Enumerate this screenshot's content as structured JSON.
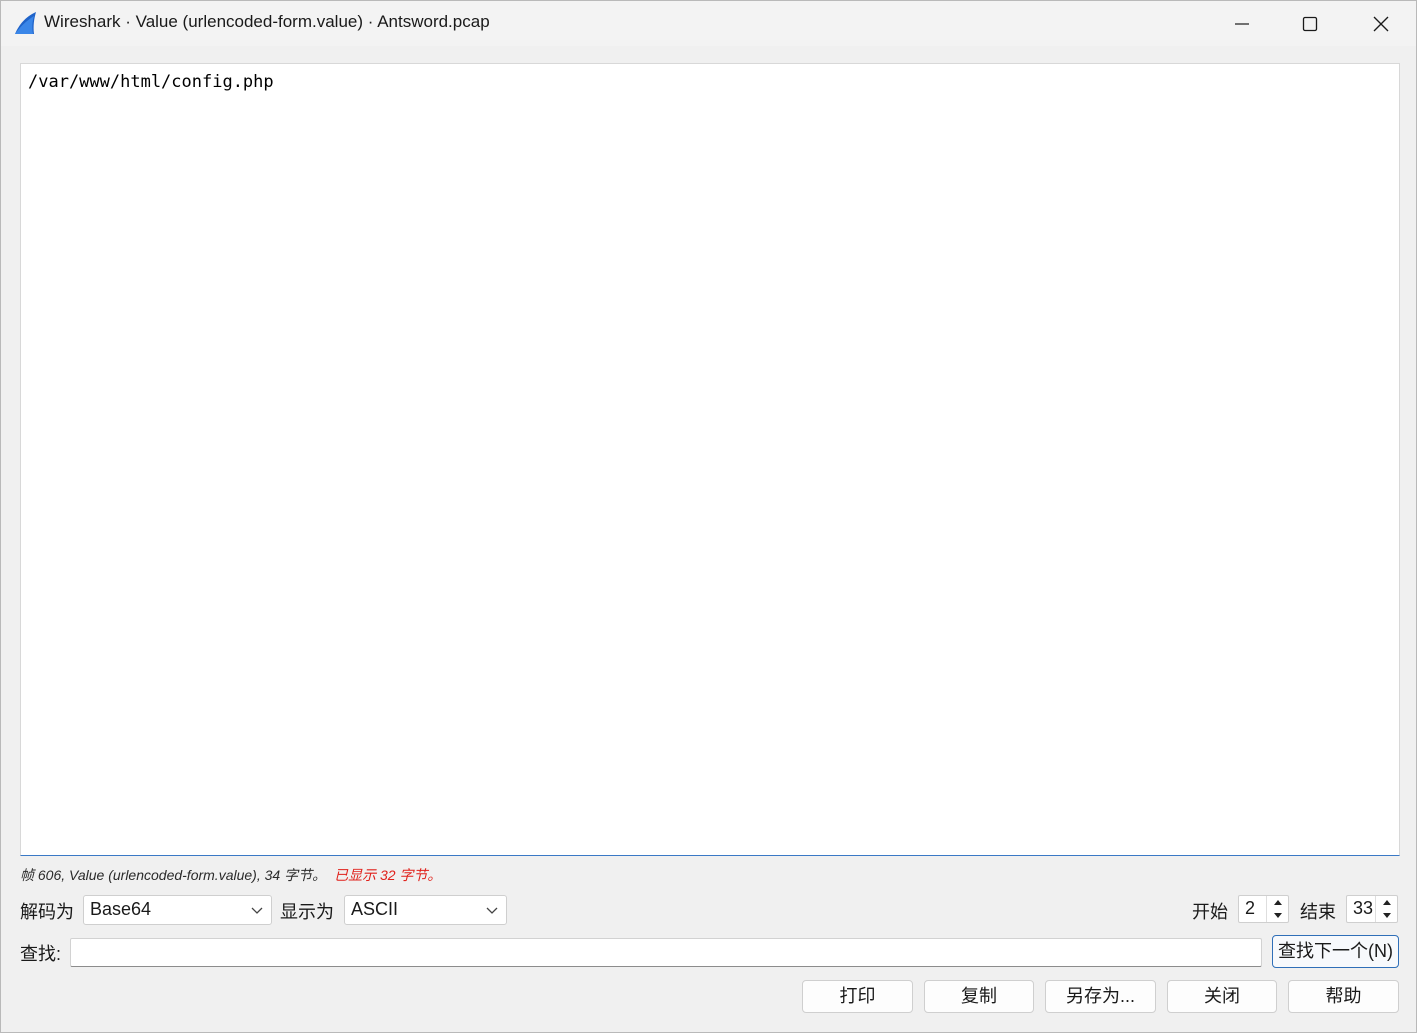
{
  "window": {
    "title": "Wireshark · Value (urlencoded-form.value) · Antsword.pcap"
  },
  "content": {
    "text": "/var/www/html/config.php"
  },
  "info": {
    "summary": "帧 606, Value (urlencoded-form.value), 34 字节。",
    "shown": "已显示 32 字节。"
  },
  "controls": {
    "decode_label": "解码为",
    "decode_value": "Base64",
    "show_label": "显示为",
    "show_value": "ASCII",
    "start_label": "开始",
    "start_value": "2",
    "end_label": "结束",
    "end_value": "33"
  },
  "find": {
    "label": "查找:",
    "value": "",
    "next_button": "查找下一个(N)"
  },
  "buttons": {
    "print": "打印",
    "copy": "复制",
    "save_as": "另存为...",
    "close": "关闭",
    "help": "帮助"
  },
  "colors": {
    "accent": "#3a79c6",
    "warning": "#e0201a"
  }
}
